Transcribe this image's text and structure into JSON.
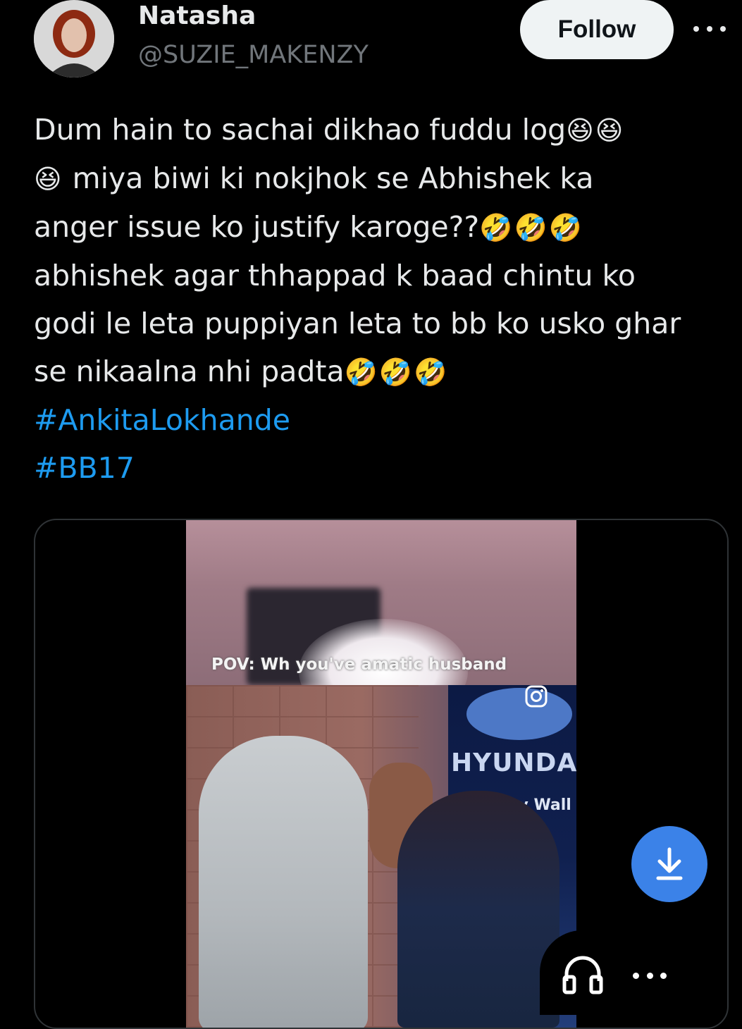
{
  "author": {
    "name": "Natasha",
    "handle": "@SUZIE_MAKENZY"
  },
  "follow_label": "Follow",
  "tweet": {
    "lines": [
      {
        "text": "Dum hain to sachai dikhao fuddu log",
        "emoji": "😆😆"
      },
      {
        "emoji_prefix": "😆",
        "text": " miya biwi ki nokjhok se Abhishek ka"
      },
      {
        "text": "anger issue ko justify karoge??",
        "emoji": "🤣🤣🤣"
      },
      {
        "text": "abhishek agar thhappad k baad chintu ko"
      },
      {
        "text": "godi le leta puppiyan leta to bb ko usko ghar"
      },
      {
        "text": "se nikaalna nhi padta",
        "emoji": "🤣🤣🤣"
      }
    ],
    "hashtags": [
      "#AnkitaLokhande",
      "#BB17"
    ]
  },
  "media": {
    "caption": "POV: Wh   you've    amatic husband",
    "brand_text": "HYUNDA",
    "wall_text": "ety Wall"
  },
  "icons": {
    "more_top": "more-horizontal-icon",
    "download": "download-icon",
    "audio": "headphones-icon",
    "more_bottom": "more-horizontal-icon",
    "instagram": "instagram-icon"
  },
  "colors": {
    "background": "#000000",
    "text": "#e7e9ea",
    "secondary": "#71767b",
    "hashtag": "#1d9bf0",
    "follow_bg": "#eff3f4",
    "download_bg": "#3b82e8"
  }
}
